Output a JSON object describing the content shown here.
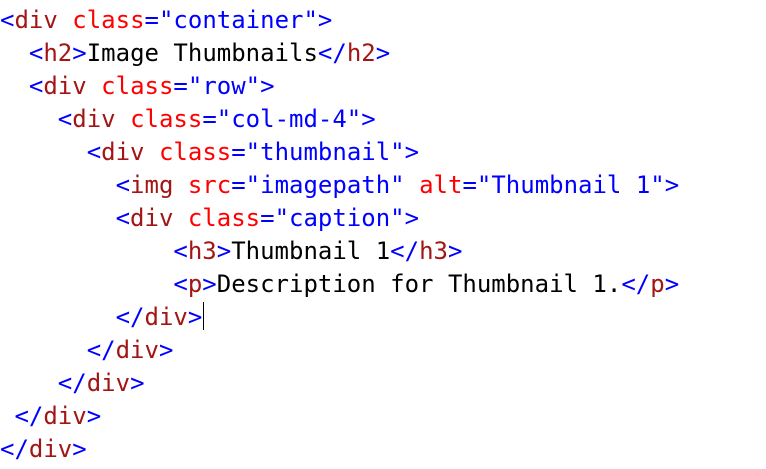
{
  "editor": {
    "lines": [
      {
        "indent": "",
        "tokens": [
          {
            "t": "punc",
            "v": "<"
          },
          {
            "t": "tag",
            "v": "div"
          },
          {
            "t": "text",
            "v": " "
          },
          {
            "t": "attr",
            "v": "class"
          },
          {
            "t": "eq",
            "v": "="
          },
          {
            "t": "val",
            "v": "\"container\""
          },
          {
            "t": "punc",
            "v": ">"
          }
        ]
      },
      {
        "indent": "  ",
        "tokens": [
          {
            "t": "punc",
            "v": "<"
          },
          {
            "t": "tag",
            "v": "h2"
          },
          {
            "t": "punc",
            "v": ">"
          },
          {
            "t": "text",
            "v": "Image Thumbnails"
          },
          {
            "t": "punc",
            "v": "</"
          },
          {
            "t": "tag",
            "v": "h2"
          },
          {
            "t": "punc",
            "v": ">"
          }
        ]
      },
      {
        "indent": "  ",
        "tokens": [
          {
            "t": "punc",
            "v": "<"
          },
          {
            "t": "tag",
            "v": "div"
          },
          {
            "t": "text",
            "v": " "
          },
          {
            "t": "attr",
            "v": "class"
          },
          {
            "t": "eq",
            "v": "="
          },
          {
            "t": "val",
            "v": "\"row\""
          },
          {
            "t": "punc",
            "v": ">"
          }
        ]
      },
      {
        "indent": "    ",
        "tokens": [
          {
            "t": "punc",
            "v": "<"
          },
          {
            "t": "tag",
            "v": "div"
          },
          {
            "t": "text",
            "v": " "
          },
          {
            "t": "attr",
            "v": "class"
          },
          {
            "t": "eq",
            "v": "="
          },
          {
            "t": "val",
            "v": "\"col-md-4\""
          },
          {
            "t": "punc",
            "v": ">"
          }
        ]
      },
      {
        "indent": "      ",
        "tokens": [
          {
            "t": "punc",
            "v": "<"
          },
          {
            "t": "tag",
            "v": "div"
          },
          {
            "t": "text",
            "v": " "
          },
          {
            "t": "attr",
            "v": "class"
          },
          {
            "t": "eq",
            "v": "="
          },
          {
            "t": "val",
            "v": "\"thumbnail\""
          },
          {
            "t": "punc",
            "v": ">"
          }
        ]
      },
      {
        "indent": "        ",
        "tokens": [
          {
            "t": "punc",
            "v": "<"
          },
          {
            "t": "tag",
            "v": "img"
          },
          {
            "t": "text",
            "v": " "
          },
          {
            "t": "attr",
            "v": "src"
          },
          {
            "t": "eq",
            "v": "="
          },
          {
            "t": "val",
            "v": "\"imagepath\""
          },
          {
            "t": "text",
            "v": " "
          },
          {
            "t": "attr",
            "v": "alt"
          },
          {
            "t": "eq",
            "v": "="
          },
          {
            "t": "val",
            "v": "\"Thumbnail 1\""
          },
          {
            "t": "punc",
            "v": ">"
          }
        ]
      },
      {
        "indent": "        ",
        "tokens": [
          {
            "t": "punc",
            "v": "<"
          },
          {
            "t": "tag",
            "v": "div"
          },
          {
            "t": "text",
            "v": " "
          },
          {
            "t": "attr",
            "v": "class"
          },
          {
            "t": "eq",
            "v": "="
          },
          {
            "t": "val",
            "v": "\"caption\""
          },
          {
            "t": "punc",
            "v": ">"
          }
        ]
      },
      {
        "indent": "            ",
        "tokens": [
          {
            "t": "punc",
            "v": "<"
          },
          {
            "t": "tag",
            "v": "h3"
          },
          {
            "t": "punc",
            "v": ">"
          },
          {
            "t": "text",
            "v": "Thumbnail 1"
          },
          {
            "t": "punc",
            "v": "</"
          },
          {
            "t": "tag",
            "v": "h3"
          },
          {
            "t": "punc",
            "v": ">"
          }
        ]
      },
      {
        "indent": "            ",
        "tokens": [
          {
            "t": "punc",
            "v": "<"
          },
          {
            "t": "tag",
            "v": "p"
          },
          {
            "t": "punc",
            "v": ">"
          },
          {
            "t": "text",
            "v": "Description for Thumbnail 1."
          },
          {
            "t": "punc",
            "v": "</"
          },
          {
            "t": "tag",
            "v": "p"
          },
          {
            "t": "punc",
            "v": ">"
          }
        ]
      },
      {
        "indent": "        ",
        "caret": true,
        "tokens": [
          {
            "t": "punc",
            "v": "</"
          },
          {
            "t": "tag",
            "v": "div"
          },
          {
            "t": "punc",
            "v": ">"
          }
        ]
      },
      {
        "indent": "      ",
        "tokens": [
          {
            "t": "punc",
            "v": "</"
          },
          {
            "t": "tag",
            "v": "div"
          },
          {
            "t": "punc",
            "v": ">"
          }
        ]
      },
      {
        "indent": "    ",
        "tokens": [
          {
            "t": "punc",
            "v": "</"
          },
          {
            "t": "tag",
            "v": "div"
          },
          {
            "t": "punc",
            "v": ">"
          }
        ]
      },
      {
        "indent": " ",
        "tokens": [
          {
            "t": "punc",
            "v": "</"
          },
          {
            "t": "tag",
            "v": "div"
          },
          {
            "t": "punc",
            "v": ">"
          }
        ]
      },
      {
        "indent": "",
        "tokens": [
          {
            "t": "punc",
            "v": "</"
          },
          {
            "t": "tag",
            "v": "div"
          },
          {
            "t": "punc",
            "v": ">"
          }
        ]
      }
    ]
  }
}
